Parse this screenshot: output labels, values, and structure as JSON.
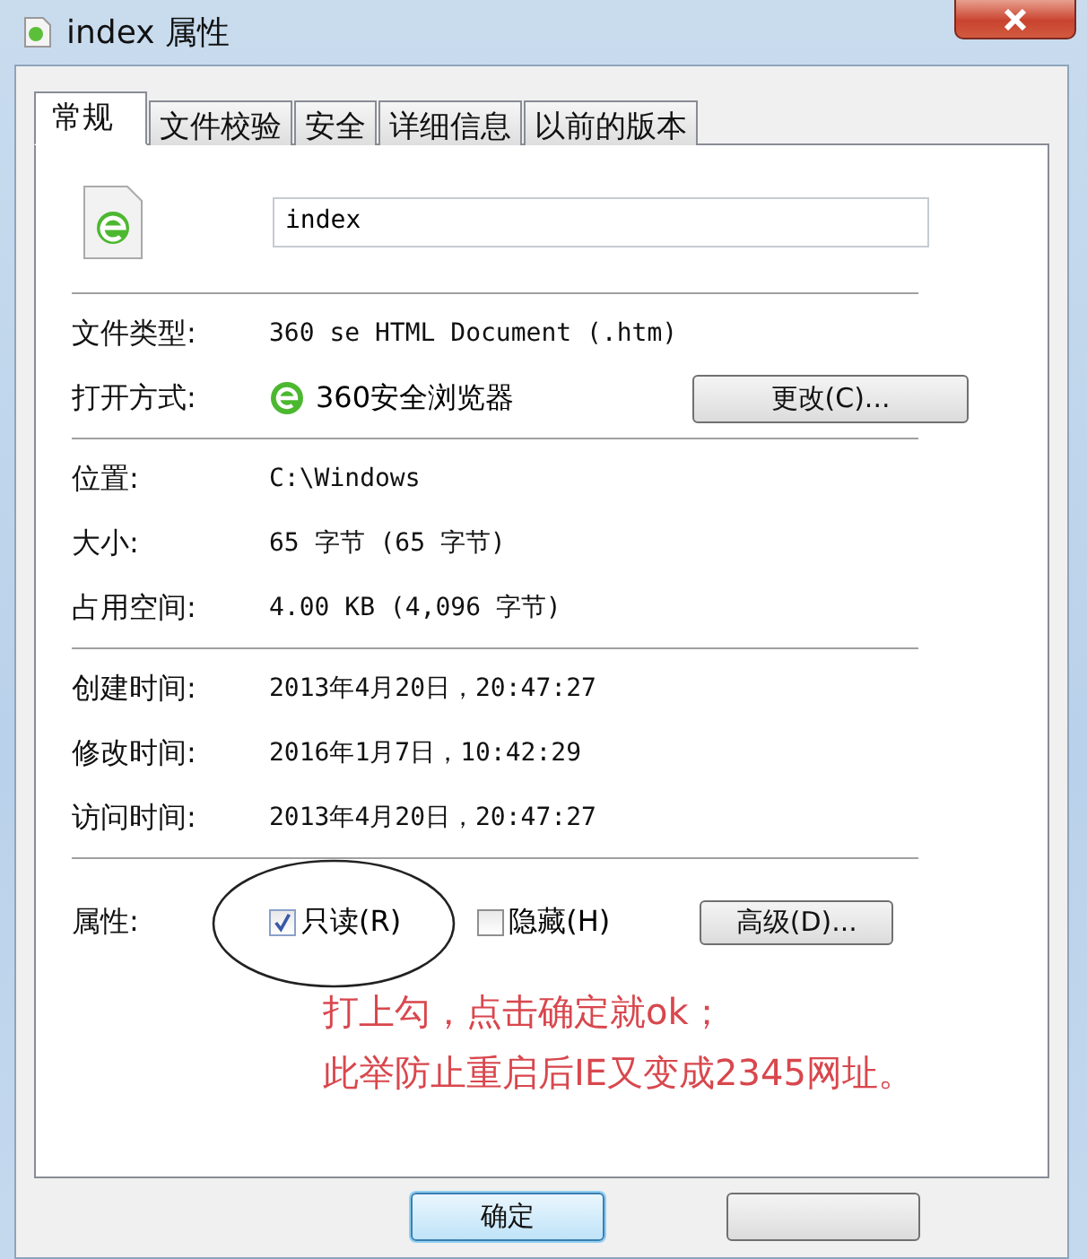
{
  "window": {
    "title": "index 属性"
  },
  "tabs": [
    {
      "label": "常规",
      "selected": true
    },
    {
      "label": "文件校验",
      "selected": false
    },
    {
      "label": "安全",
      "selected": false
    },
    {
      "label": "详细信息",
      "selected": false
    },
    {
      "label": "以前的版本",
      "selected": false
    }
  ],
  "file_name": "index",
  "type_row": {
    "label": "文件类型:",
    "value": "360 se HTML Document (.htm)"
  },
  "open_with": {
    "label": "打开方式:",
    "app": "360安全浏览器",
    "button": "更改(C)..."
  },
  "location_rows": [
    {
      "label": "位置:",
      "value": "C:\\Windows"
    },
    {
      "label": "大小:",
      "value": "65 字节 (65 字节)"
    },
    {
      "label": "占用空间:",
      "value": "4.00 KB (4,096 字节)"
    }
  ],
  "time_rows": [
    {
      "label": "创建时间:",
      "value": "2013年4月20日，20:47:27"
    },
    {
      "label": "修改时间:",
      "value": "2016年1月7日，10:42:29"
    },
    {
      "label": "访问时间:",
      "value": "2013年4月20日，20:47:27"
    }
  ],
  "attributes": {
    "label": "属性:",
    "items": [
      {
        "label": "只读(R)",
        "checked": true
      },
      {
        "label": "隐藏(H)",
        "checked": false
      }
    ],
    "button": "高级(D)..."
  },
  "annotation": [
    "打上勾，点击确定就ok；",
    "此举防止重启后IE又变成2345网址。"
  ],
  "buttons": [
    "确定"
  ]
}
